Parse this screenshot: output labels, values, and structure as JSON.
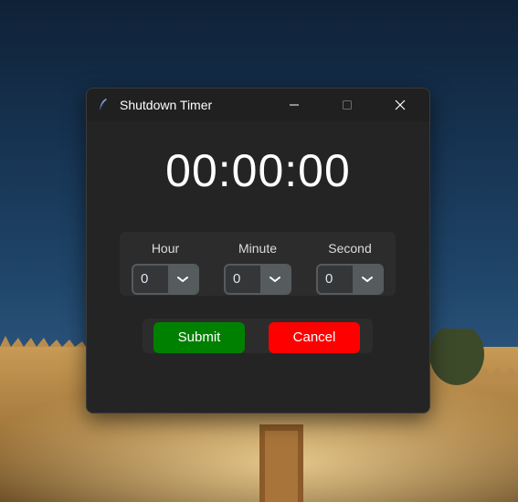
{
  "window": {
    "title": "Shutdown Timer",
    "icon": "feather-icon"
  },
  "titlebar_controls": {
    "minimize_icon": "minimize-icon",
    "maximize_icon": "maximize-icon",
    "close_icon": "close-icon"
  },
  "timer": {
    "display": "00:00:00"
  },
  "pickers": [
    {
      "label": "Hour",
      "value": "0"
    },
    {
      "label": "Minute",
      "value": "0"
    },
    {
      "label": "Second",
      "value": "0"
    }
  ],
  "buttons": {
    "submit_label": "Submit",
    "cancel_label": "Cancel"
  },
  "colors": {
    "window_bg": "#242424",
    "submit_bg": "#008000",
    "cancel_bg": "#ff0000",
    "combo_bg": "#343638",
    "combo_border": "#565b5e"
  }
}
